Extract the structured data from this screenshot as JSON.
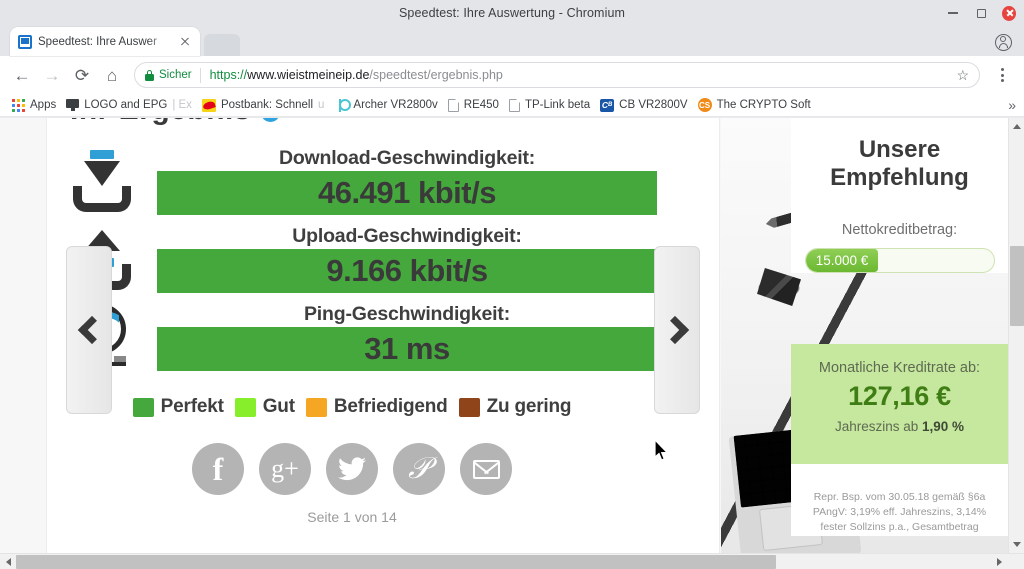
{
  "browser": {
    "window_title": "Speedtest: Ihre Auswertung - Chromium",
    "tab": {
      "title": "Speedtest: Ihre Auswer",
      "favicon": "monitor-icon",
      "close": "×"
    },
    "window_controls": {
      "minimize": "minimize-icon",
      "maximize": "maximize-icon",
      "close": "close-icon"
    },
    "toolbar": {
      "back": "←",
      "forward": "→",
      "reload": "⟳",
      "home": "⌂",
      "security_label": "Sicher",
      "url_scheme": "https://",
      "url_host": "www.wieistmeineip.de",
      "url_path": "/speedtest/ergebnis.php",
      "bookmark_star": "☆",
      "menu": "chrome-menu-icon"
    },
    "bookmarks": [
      {
        "label": "Apps",
        "icon": "apps-grid-icon"
      },
      {
        "label": "LOGO and EPG",
        "label_faded": "| Ex",
        "icon": "monitor-icon"
      },
      {
        "label": "Postbank: Schnell",
        "label_faded": "u",
        "icon": "postbank-icon"
      },
      {
        "label": "Archer VR2800v",
        "icon": "tplink-icon"
      },
      {
        "label": "RE450",
        "icon": "document-icon"
      },
      {
        "label": "TP-Link beta",
        "icon": "document-icon"
      },
      {
        "label": "CB VR2800V",
        "icon": "cb-icon"
      },
      {
        "label": "The CRYPTO Soft",
        "icon": "crypto-icon"
      }
    ],
    "bookmarks_overflow": "»"
  },
  "page": {
    "heading": "Ihr Ergebnis",
    "carousel": {
      "prev": "previous-slide",
      "next": "next-slide"
    },
    "results": [
      {
        "icon": "download-icon",
        "label": "Download-Geschwindigkeit:",
        "value": "46.491 kbit/s",
        "rating": "Perfekt",
        "color": "#45a83c"
      },
      {
        "icon": "upload-icon",
        "label": "Upload-Geschwindigkeit:",
        "value": "9.166 kbit/s",
        "rating": "Perfekt",
        "color": "#45a83c"
      },
      {
        "icon": "ping-gauge-icon",
        "label": "Ping-Geschwindigkeit:",
        "value": "31 ms",
        "rating": "Perfekt",
        "color": "#45a83c"
      }
    ],
    "legend": [
      {
        "label": "Perfekt",
        "color": "#45a83c"
      },
      {
        "label": "Gut",
        "color": "#86ee2a"
      },
      {
        "label": "Befriedigend",
        "color": "#f5a623"
      },
      {
        "label": "Zu gering",
        "color": "#8f4419"
      }
    ],
    "social": [
      {
        "name": "facebook",
        "glyph": "f"
      },
      {
        "name": "googleplus",
        "glyph": "g+"
      },
      {
        "name": "twitter",
        "glyph": "🐦"
      },
      {
        "name": "pinterest",
        "glyph": "𝒫"
      },
      {
        "name": "email",
        "glyph": "envelope-icon"
      }
    ],
    "pager": "Seite 1 von 14"
  },
  "ad": {
    "title_line1": "Unsere",
    "title_line2": "Empfehlung",
    "amount_label": "Nettokreditbetrag:",
    "amount_value": "15.000 €",
    "rate_label": "Monatliche Kreditrate ab:",
    "rate_value": "127,16 €",
    "interest_prefix": "Jahreszins ab ",
    "interest_value": "1,90 %",
    "fineprint": "Repr. Bsp.  vom 30.05.18 gemäß §6a PAngV: 3,19% eff. Jahreszins, 3,14% fester Sollzins p.a., Gesamtbetrag"
  },
  "chart_data": {
    "type": "bar",
    "title": "Ihr Ergebnis",
    "categories": [
      "Download-Geschwindigkeit:",
      "Upload-Geschwindigkeit:",
      "Ping-Geschwindigkeit:"
    ],
    "values": [
      46491,
      9166,
      31
    ],
    "value_labels": [
      "46.491 kbit/s",
      "9.166 kbit/s",
      "31 ms"
    ],
    "units": [
      "kbit/s",
      "kbit/s",
      "ms"
    ],
    "ratings": [
      "Perfekt",
      "Perfekt",
      "Perfekt"
    ],
    "bar_colors": [
      "#45a83c",
      "#45a83c",
      "#45a83c"
    ],
    "legend": [
      {
        "label": "Perfekt",
        "color": "#45a83c"
      },
      {
        "label": "Gut",
        "color": "#86ee2a"
      },
      {
        "label": "Befriedigend",
        "color": "#f5a623"
      },
      {
        "label": "Zu gering",
        "color": "#8f4419"
      }
    ],
    "legend_position": "bottom",
    "grid": false,
    "xlabel": "",
    "ylabel": ""
  }
}
